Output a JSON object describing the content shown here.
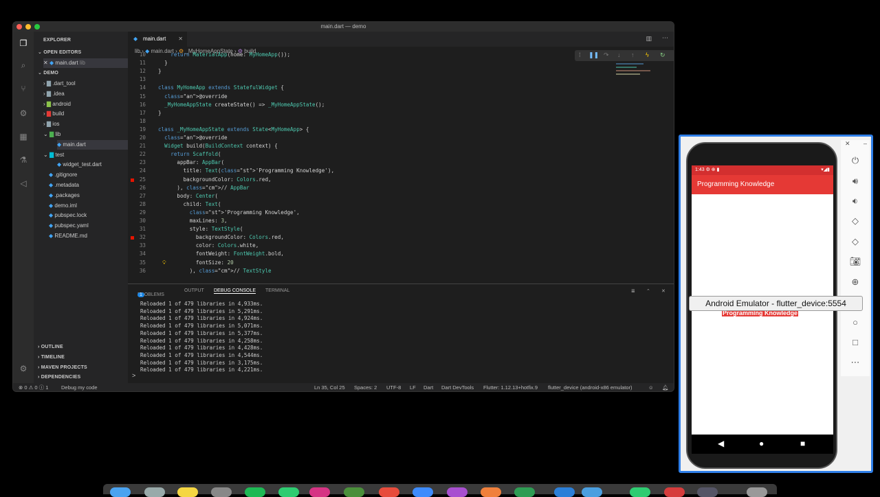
{
  "window_title": "main.dart — demo",
  "sidebar": {
    "explorer_label": "EXPLORER",
    "open_editors_label": "OPEN EDITORS",
    "open_file": "main.dart",
    "open_file_dir": "lib",
    "project": "DEMO",
    "items": [
      {
        "label": ".dart_tool",
        "kind": "folder"
      },
      {
        "label": ".idea",
        "kind": "folder"
      },
      {
        "label": "android",
        "kind": "folder"
      },
      {
        "label": "build",
        "kind": "folder"
      },
      {
        "label": "ios",
        "kind": "folder"
      },
      {
        "label": "lib",
        "kind": "folder-open"
      },
      {
        "label": "main.dart",
        "kind": "file"
      },
      {
        "label": "test",
        "kind": "folder-open"
      },
      {
        "label": "widget_test.dart",
        "kind": "file"
      },
      {
        "label": ".gitignore",
        "kind": "file"
      },
      {
        "label": ".metadata",
        "kind": "file"
      },
      {
        "label": ".packages",
        "kind": "file"
      },
      {
        "label": "demo.iml",
        "kind": "file"
      },
      {
        "label": "pubspec.lock",
        "kind": "file"
      },
      {
        "label": "pubspec.yaml",
        "kind": "file"
      },
      {
        "label": "README.md",
        "kind": "file"
      }
    ],
    "outline": "OUTLINE",
    "timeline": "TIMELINE",
    "maven": "MAVEN PROJECTS",
    "dependencies": "DEPENDENCIES"
  },
  "editor": {
    "tab": "main.dart",
    "breadcrumb": [
      "lib",
      "main.dart",
      "_MyHomeAppState",
      "build"
    ]
  },
  "code_lines": [
    {
      "n": "10",
      "t": "    return MaterialApp(home: MyHomeApp());"
    },
    {
      "n": "11",
      "t": "  }"
    },
    {
      "n": "12",
      "t": "}"
    },
    {
      "n": "13",
      "t": ""
    },
    {
      "n": "14",
      "t": "class MyHomeApp extends StatefulWidget {"
    },
    {
      "n": "15",
      "t": "  @override"
    },
    {
      "n": "16",
      "t": "  _MyHomeAppState createState() => _MyHomeAppState();"
    },
    {
      "n": "17",
      "t": "}"
    },
    {
      "n": "18",
      "t": ""
    },
    {
      "n": "19",
      "t": "class _MyHomeAppState extends State<MyHomeApp> {"
    },
    {
      "n": "20",
      "t": "  @override"
    },
    {
      "n": "21",
      "t": "  Widget build(BuildContext context) {"
    },
    {
      "n": "22",
      "t": "    return Scaffold("
    },
    {
      "n": "23",
      "t": "      appBar: AppBar("
    },
    {
      "n": "24",
      "t": "        title: Text('Programming Knowledge'),"
    },
    {
      "n": "25",
      "t": "        backgroundColor: Colors.red,"
    },
    {
      "n": "26",
      "t": "      ), // AppBar"
    },
    {
      "n": "27",
      "t": "      body: Center("
    },
    {
      "n": "28",
      "t": "        child: Text("
    },
    {
      "n": "29",
      "t": "          'Programming Knowledge',"
    },
    {
      "n": "30",
      "t": "          maxLines: 3,"
    },
    {
      "n": "31",
      "t": "          style: TextStyle("
    },
    {
      "n": "32",
      "t": "            backgroundColor: Colors.red,"
    },
    {
      "n": "33",
      "t": "            color: Colors.white,"
    },
    {
      "n": "34",
      "t": "            fontWeight: FontWeight.bold,"
    },
    {
      "n": "35",
      "t": "            fontSize: 20"
    },
    {
      "n": "36",
      "t": "          ), // TextStyle"
    }
  ],
  "panel": {
    "tabs": [
      "PROBLEMS",
      "OUTPUT",
      "DEBUG CONSOLE",
      "TERMINAL"
    ],
    "problems_count": "1",
    "console_lines": [
      "Reloaded 1 of 479 libraries in 4,933ms.",
      "Reloaded 1 of 479 libraries in 5,291ms.",
      "Reloaded 1 of 479 libraries in 4,924ms.",
      "Reloaded 1 of 479 libraries in 5,071ms.",
      "Reloaded 1 of 479 libraries in 5,377ms.",
      "Reloaded 1 of 479 libraries in 4,258ms.",
      "Reloaded 1 of 479 libraries in 4,428ms.",
      "Reloaded 1 of 479 libraries in 4,544ms.",
      "Reloaded 1 of 479 libraries in 3,175ms.",
      "Reloaded 1 of 479 libraries in 4,221ms."
    ],
    "prompt": ">"
  },
  "status": {
    "errors": "⊗ 0 ⚠ 0 ⓘ 1",
    "debug": "Debug my code",
    "position": "Ln 35, Col 25",
    "spaces": "Spaces: 2",
    "encoding": "UTF-8",
    "eol": "LF",
    "language": "Dart",
    "devtools": "Dart DevTools",
    "flutter": "Flutter: 1.12.13+hotfix.9",
    "device": "flutter_device (android-x86 emulator)"
  },
  "emulator": {
    "time": "1:43",
    "app_title": "Programming Knowledge",
    "body_text": "Programming Knowledge",
    "tooltip": "Android Emulator - flutter_device:5554",
    "accent_color": "#e53935"
  }
}
